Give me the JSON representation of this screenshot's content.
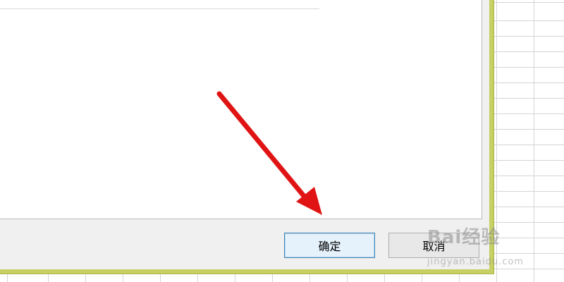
{
  "dialog": {
    "ok_label": "确定",
    "cancel_label": "取消"
  },
  "watermark": {
    "logo_text": "Bai经验",
    "url_text": "jingyan.baidu.com"
  },
  "colors": {
    "frame": "#c7d064",
    "arrow": "#e01414"
  },
  "annotation": {
    "arrow_icon": "red-arrow-icon"
  }
}
